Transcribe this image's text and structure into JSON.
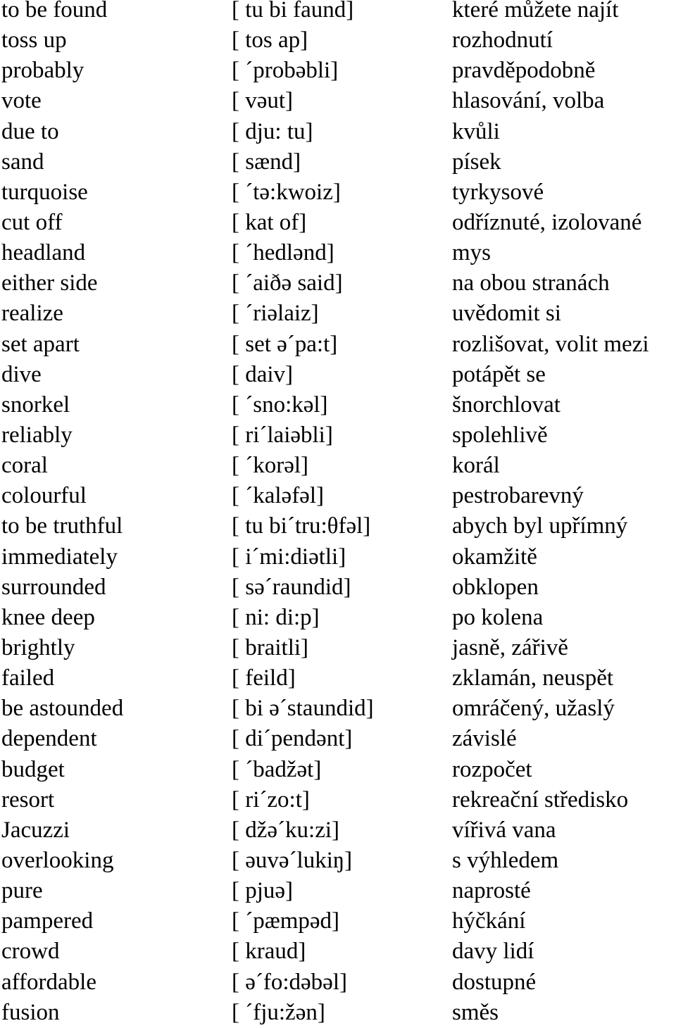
{
  "vocabulary": [
    {
      "en": "to be found",
      "ph": "[ tu bi faund]",
      "cz": "které můžete najít"
    },
    {
      "en": "toss up",
      "ph": "[ tos ap]",
      "cz": "rozhodnutí"
    },
    {
      "en": "probably",
      "ph": "[ ´probəbli]",
      "cz": "pravděpodobně"
    },
    {
      "en": "vote",
      "ph": "[ vəut]",
      "cz": "hlasování, volba"
    },
    {
      "en": "due to",
      "ph": "[ dju: tu]",
      "cz": "kvůli"
    },
    {
      "en": "sand",
      "ph": "[ sænd]",
      "cz": "písek"
    },
    {
      "en": "turquoise",
      "ph": "[ ´tə:kwoiz]",
      "cz": "tyrkysové"
    },
    {
      "en": "cut off",
      "ph": "[ kat of]",
      "cz": "odříznuté, izolované"
    },
    {
      "en": "headland",
      "ph": "[ ´hedlənd]",
      "cz": "mys"
    },
    {
      "en": "either side",
      "ph": "[ ´aiðə said]",
      "cz": "na obou stranách"
    },
    {
      "en": "realize",
      "ph": "[ ´riəlaiz]",
      "cz": "uvědomit si"
    },
    {
      "en": "set apart",
      "ph": "[ set ə´pa:t]",
      "cz": "rozlišovat, volit mezi"
    },
    {
      "en": "dive",
      "ph": "[ daiv]",
      "cz": "potápět se"
    },
    {
      "en": "snorkel",
      "ph": "[ ´sno:kəl]",
      "cz": "šnorchlovat"
    },
    {
      "en": "reliably",
      "ph": "[ ri´laiəbli]",
      "cz": "spolehlivě"
    },
    {
      "en": "coral",
      "ph": "[ ´korəl]",
      "cz": "korál"
    },
    {
      "en": "colourful",
      "ph": "[ ´kaləfəl]",
      "cz": "pestrobarevný"
    },
    {
      "en": "to be truthful",
      "ph": "[ tu bi´tru:θfəl]",
      "cz": "abych byl upřímný"
    },
    {
      "en": "immediately",
      "ph": "[ i´mi:diətli]",
      "cz": "okamžitě"
    },
    {
      "en": "surrounded",
      "ph": "[ sə´raundid]",
      "cz": "obklopen"
    },
    {
      "en": "knee deep",
      "ph": "[ ni: di:p]",
      "cz": "po kolena"
    },
    {
      "en": "brightly",
      "ph": "[ braitli]",
      "cz": "jasně, zářivě"
    },
    {
      "en": "failed",
      "ph": "[ feild]",
      "cz": "zklamán, neuspět"
    },
    {
      "en": "be astounded",
      "ph": "[ bi ə´staundid]",
      "cz": "omráčený, užaslý"
    },
    {
      "en": "dependent",
      "ph": "[ di´pendənt]",
      "cz": "závislé"
    },
    {
      "en": "budget",
      "ph": "[ ´badžət]",
      "cz": "rozpočet"
    },
    {
      "en": "resort",
      "ph": "[ ri´zo:t]",
      "cz": "rekreační středisko"
    },
    {
      "en": "Jacuzzi",
      "ph": "[ džə´ku:zi]",
      "cz": "vířivá vana"
    },
    {
      "en": "overlooking",
      "ph": "[ əuvə´lukiŋ]",
      "cz": "s výhledem"
    },
    {
      "en": "pure",
      "ph": "[ pjuə]",
      "cz": "naprosté"
    },
    {
      "en": "pampered",
      "ph": "[ ´pæmpəd]",
      "cz": "hýčkání"
    },
    {
      "en": "crowd",
      "ph": "[ kraud]",
      "cz": "davy lidí"
    },
    {
      "en": "affordable",
      "ph": "[ ə´fo:dəbəl]",
      "cz": "dostupné"
    },
    {
      "en": "fusion",
      "ph": "[ ´fju:žən]",
      "cz": "směs"
    }
  ]
}
